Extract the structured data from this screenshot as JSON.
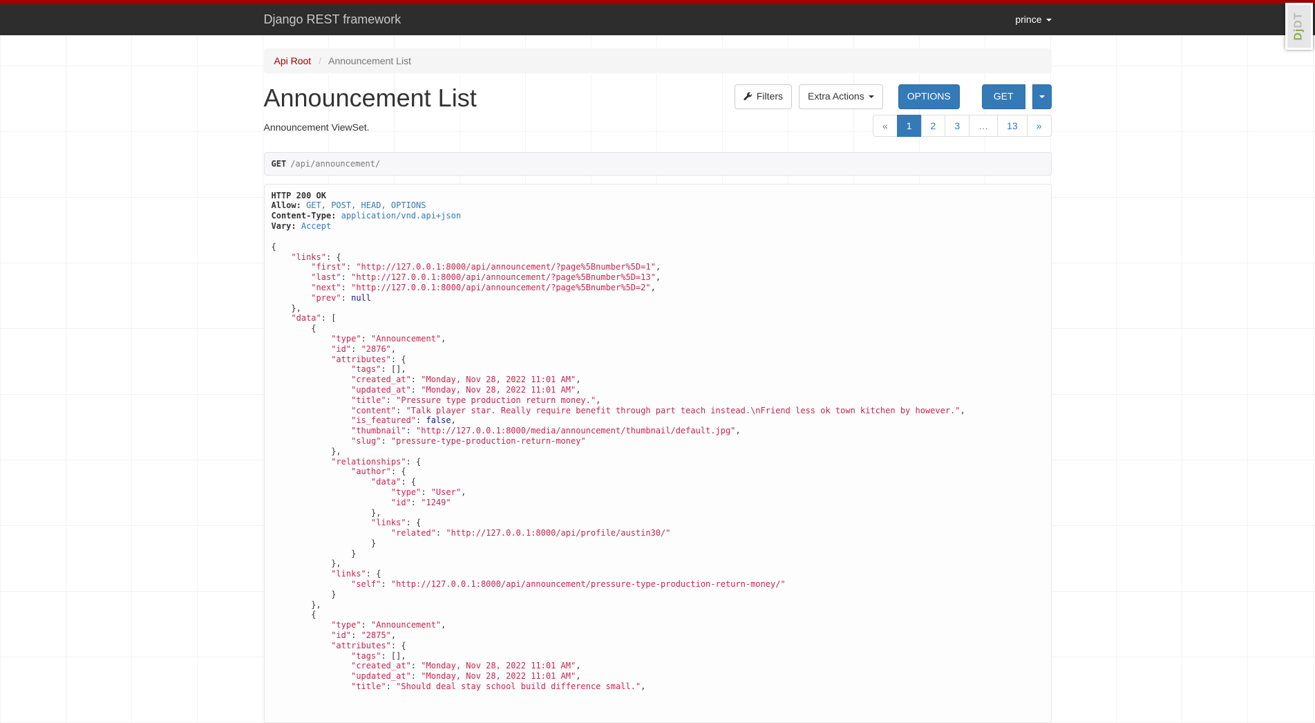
{
  "navbar": {
    "brand": "Django REST framework",
    "user": "prince"
  },
  "djdt": {
    "dj": "Dj",
    "dt": "DT"
  },
  "breadcrumb": {
    "root": "Api Root",
    "separator": "/",
    "current": "Announcement List"
  },
  "page": {
    "title": "Announcement List",
    "description": "Announcement ViewSet."
  },
  "toolbar": {
    "filters_label": "Filters",
    "extra_actions_label": "Extra Actions",
    "options_label": "OPTIONS",
    "get_label": "GET"
  },
  "pagination": {
    "items": [
      {
        "label": "«",
        "state": "disabled"
      },
      {
        "label": "1",
        "state": "active"
      },
      {
        "label": "2"
      },
      {
        "label": "3"
      },
      {
        "label": "…",
        "state": "disabled"
      },
      {
        "label": "13"
      },
      {
        "label": "»"
      }
    ]
  },
  "request": {
    "method": "GET",
    "path": "/api/announcement/"
  },
  "response": {
    "status": "HTTP 200 OK",
    "headers": [
      {
        "name": "Allow:",
        "value": "GET, POST, HEAD, OPTIONS"
      },
      {
        "name": "Content-Type:",
        "value": "application/vnd.api+json"
      },
      {
        "name": "Vary:",
        "value": "Accept"
      }
    ],
    "body": "{\n    \"links\": {\n        \"first\": \"http://127.0.0.1:8000/api/announcement/?page%5Bnumber%5D=1\",\n        \"last\": \"http://127.0.0.1:8000/api/announcement/?page%5Bnumber%5D=13\",\n        \"next\": \"http://127.0.0.1:8000/api/announcement/?page%5Bnumber%5D=2\",\n        \"prev\": null\n    },\n    \"data\": [\n        {\n            \"type\": \"Announcement\",\n            \"id\": \"2876\",\n            \"attributes\": {\n                \"tags\": [],\n                \"created_at\": \"Monday, Nov 28, 2022 11:01 AM\",\n                \"updated_at\": \"Monday, Nov 28, 2022 11:01 AM\",\n                \"title\": \"Pressure type production return money.\",\n                \"content\": \"Talk player star. Really require benefit through part teach instead.\\nFriend less ok town kitchen by however.\",\n                \"is_featured\": false,\n                \"thumbnail\": \"http://127.0.0.1:8000/media/announcement/thumbnail/default.jpg\",\n                \"slug\": \"pressure-type-production-return-money\"\n            },\n            \"relationships\": {\n                \"author\": {\n                    \"data\": {\n                        \"type\": \"User\",\n                        \"id\": \"1249\"\n                    },\n                    \"links\": {\n                        \"related\": \"http://127.0.0.1:8000/api/profile/austin30/\"\n                    }\n                }\n            },\n            \"links\": {\n                \"self\": \"http://127.0.0.1:8000/api/announcement/pressure-type-production-return-money/\"\n            }\n        },\n        {\n            \"type\": \"Announcement\",\n            \"id\": \"2875\",\n            \"attributes\": {\n                \"tags\": [],\n                \"created_at\": \"Monday, Nov 28, 2022 11:01 AM\",\n                \"updated_at\": \"Monday, Nov 28, 2022 11:01 AM\",\n                \"title\": \"Should deal stay school build difference small.\","
  },
  "colors": {
    "accent_blue": "#337ab7",
    "brand_red": "#a30000",
    "json_string": "#c7254e",
    "json_keyword": "#14148f",
    "navbar_bg": "#2d2d2d"
  }
}
